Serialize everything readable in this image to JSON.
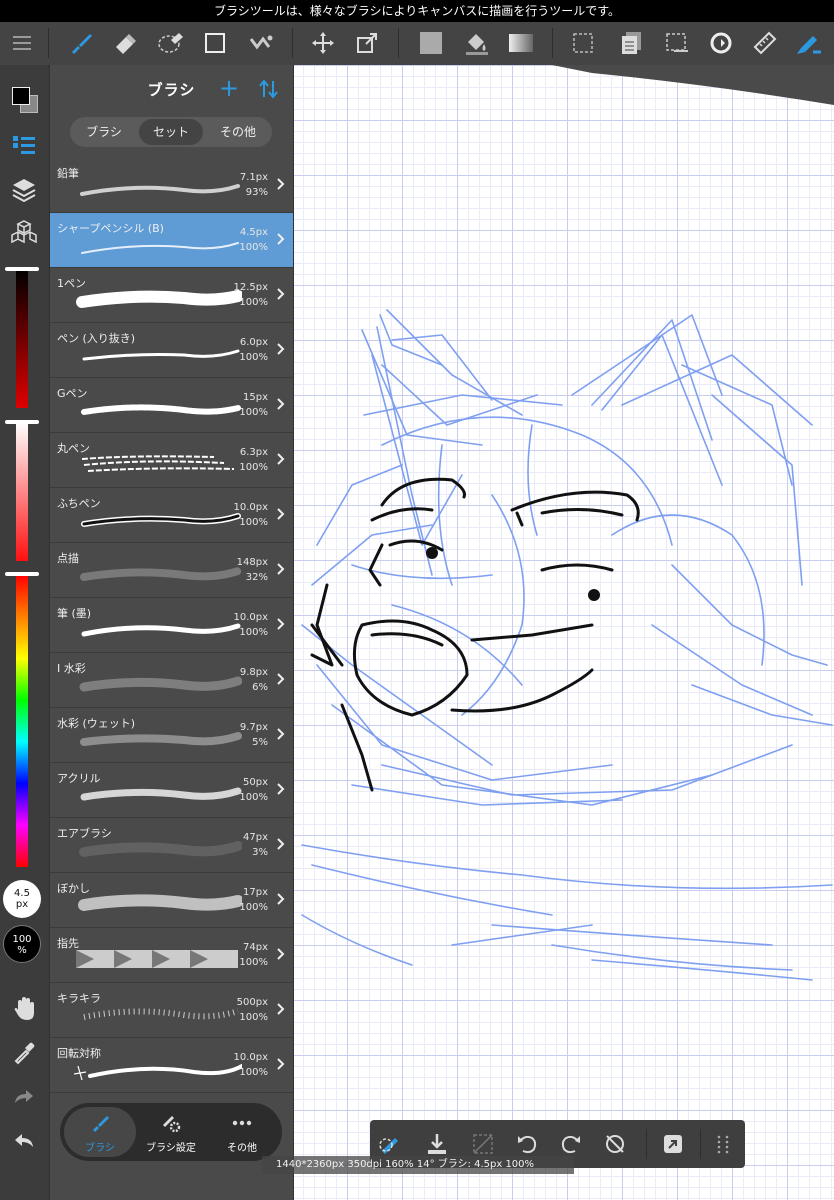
{
  "hint": "ブラシツールは、様々なブラシによりキャンバスに描画を行うツールです。",
  "colors": {
    "accent": "#2c9ae0",
    "selected_row": "#5f9bd4",
    "sketch_blue": "#7f9ff0",
    "ink": "#111111",
    "panel": "#4a4a4a",
    "toolbar": "#444444"
  },
  "toolbar": {
    "icons": [
      "menu-icon",
      "brush-tool-icon",
      "eraser-tool-icon",
      "lasso-eraser-icon",
      "rectangle-select-icon",
      "dot-tool-icon",
      "move-icon",
      "transform-icon",
      "fill-color-icon",
      "bucket-icon",
      "gradient-icon",
      "selection-icon",
      "layer-copy-icon",
      "select-area-icon",
      "rotate-canvas-icon",
      "ruler-icon",
      "pen-snap-icon"
    ]
  },
  "panel": {
    "title": "ブラシ",
    "add_symbol": "+",
    "segments": [
      "ブラシ",
      "セット",
      "その他"
    ],
    "active_segment": 1,
    "brushes": [
      {
        "name": "鉛筆",
        "size": "7.1px",
        "opacity": "93%",
        "stroke": "pencil"
      },
      {
        "name": "シャープペンシル (B)",
        "size": "4.5px",
        "opacity": "100%",
        "stroke": "sharp",
        "selected": true
      },
      {
        "name": "1ペン",
        "size": "12.5px",
        "opacity": "100%",
        "stroke": "thick"
      },
      {
        "name": "ペン (入り抜き)",
        "size": "6.0px",
        "opacity": "100%",
        "stroke": "taper"
      },
      {
        "name": "Gペン",
        "size": "15px",
        "opacity": "100%",
        "stroke": "gpen"
      },
      {
        "name": "丸ペン",
        "size": "6.3px",
        "opacity": "100%",
        "stroke": "round"
      },
      {
        "name": "ふちペン",
        "size": "10.0px",
        "opacity": "100%",
        "stroke": "edge"
      },
      {
        "name": "点描",
        "size": "148px",
        "opacity": "32%",
        "stroke": "dots"
      },
      {
        "name": "筆 (墨)",
        "size": "10.0px",
        "opacity": "100%",
        "stroke": "ink"
      },
      {
        "name": "I 水彩",
        "size": "9.8px",
        "opacity": "6%",
        "stroke": "watercolor"
      },
      {
        "name": "水彩 (ウェット)",
        "size": "9.7px",
        "opacity": "5%",
        "stroke": "wet"
      },
      {
        "name": "アクリル",
        "size": "50px",
        "opacity": "100%",
        "stroke": "acrylic"
      },
      {
        "name": "エアブラシ",
        "size": "47px",
        "opacity": "3%",
        "stroke": "airbrush"
      },
      {
        "name": "ぼかし",
        "size": "17px",
        "opacity": "100%",
        "stroke": "blur"
      },
      {
        "name": "指先",
        "size": "74px",
        "opacity": "100%",
        "stroke": "finger"
      },
      {
        "name": "キラキラ",
        "size": "500px",
        "opacity": "100%",
        "stroke": "sparkle"
      },
      {
        "name": "回転対称",
        "size": "10.0px",
        "opacity": "100%",
        "stroke": "rotation"
      }
    ],
    "tabs": [
      {
        "label": "ブラシ",
        "icon": "brush-icon"
      },
      {
        "label": "ブラシ設定",
        "icon": "brush-settings-icon"
      },
      {
        "label": "その他",
        "icon": "more-icon"
      }
    ]
  },
  "rail": {
    "size_value": "4.5",
    "size_unit": "px",
    "opacity_value": "100",
    "opacity_unit": "%"
  },
  "status": "1440*2360px 350dpi 160% 14° ブラシ: 4.5px 100%",
  "bottom_bar": {
    "icons": [
      "brush-snap-icon",
      "download-icon",
      "clear-icon",
      "undo-rotate-icon",
      "redo-rotate-icon",
      "reset-rotate-icon",
      "export-icon",
      "grid-dots-icon"
    ]
  }
}
